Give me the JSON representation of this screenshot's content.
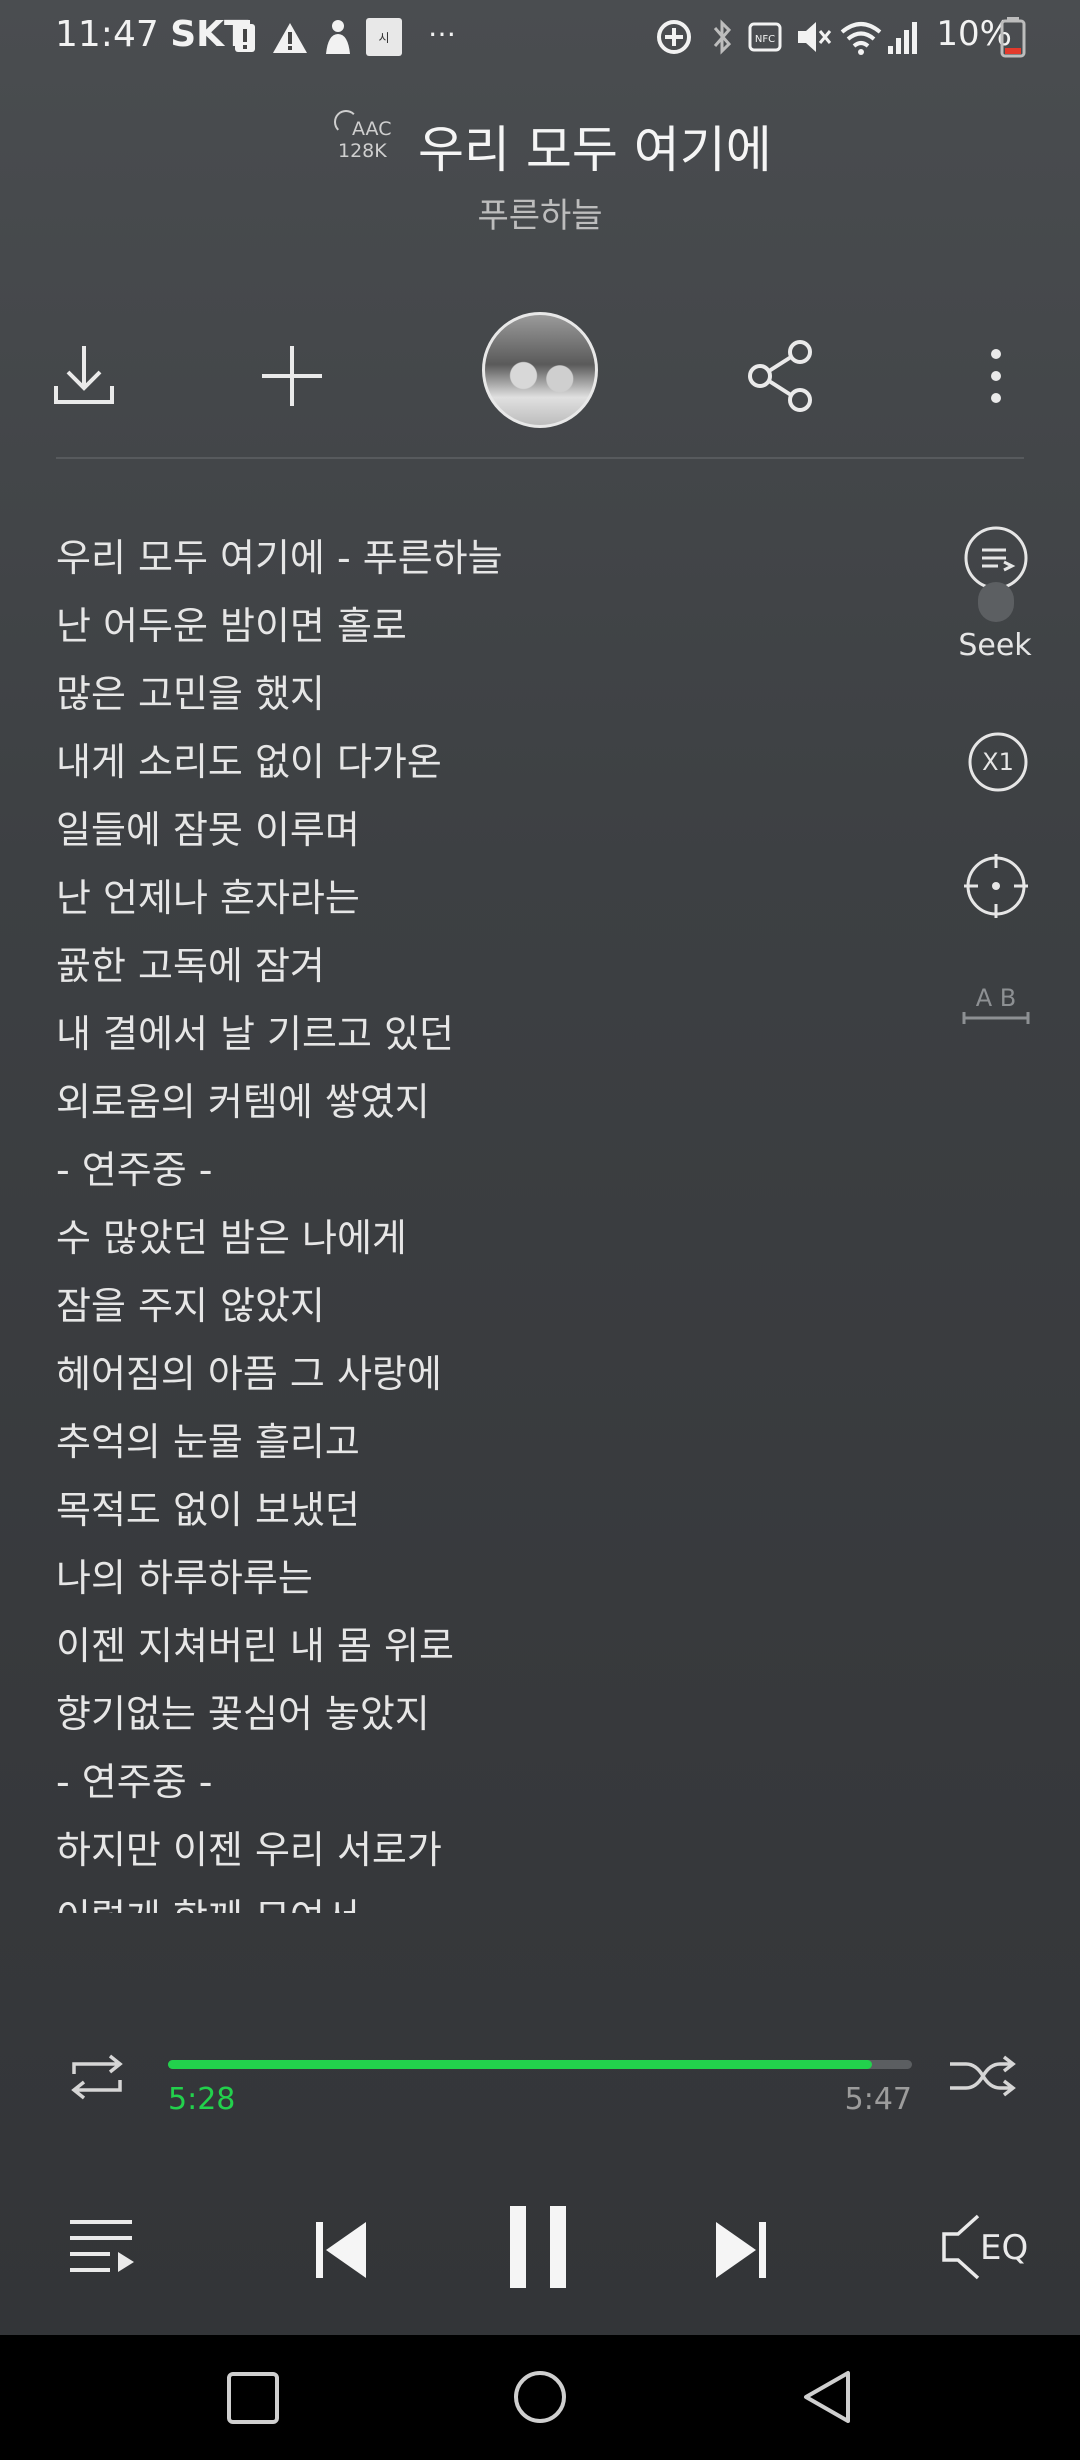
{
  "status_bar": {
    "time": "11:47",
    "carrier": "SKT",
    "battery": "10%",
    "notif_extra": "…"
  },
  "header": {
    "codec": "AAC",
    "bitrate": "128K",
    "title": "우리 모두 여기에",
    "artist": "푸른하늘"
  },
  "toolbar": {
    "icons": [
      "download-icon",
      "add-icon",
      "album-art",
      "share-icon",
      "more-icon"
    ]
  },
  "lyrics": {
    "lines": [
      "우리 모두 여기에 - 푸른하늘",
      "난 어두운 밤이면 홀로",
      "많은 고민을 했지",
      "내게 소리도 없이 다가온",
      "일들에 잠못 이루며",
      "난 언제나 혼자라는",
      "굜한 고독에 잠겨",
      "내 결에서 날 기르고 있던",
      "외로움의 커템에 쌓였지",
      "- 연주중 -",
      "수 많았던 밤은 나에게",
      "잠을 주지 않았지",
      "헤어짐의 아픔 그 사랑에",
      "추억의 눈물 흘리고",
      "목적도 없이 보냈던",
      "나의 하루하루는",
      "이젠 지쳐버린 내 몸 위로",
      "향기없는 꽃심어 놓았지",
      "- 연주중 -",
      "하지만 이젠 우리 서로가",
      "이렇게 함께 모여서"
    ]
  },
  "side_controls": {
    "seek_label": "Seek",
    "speed_label": "X1",
    "ab_label": "A B"
  },
  "progress": {
    "current": "5:28",
    "total": "5:47",
    "fraction": 0.946
  },
  "controls": {
    "eq_label": "EQ"
  },
  "colors": {
    "accent": "#22d14c"
  }
}
